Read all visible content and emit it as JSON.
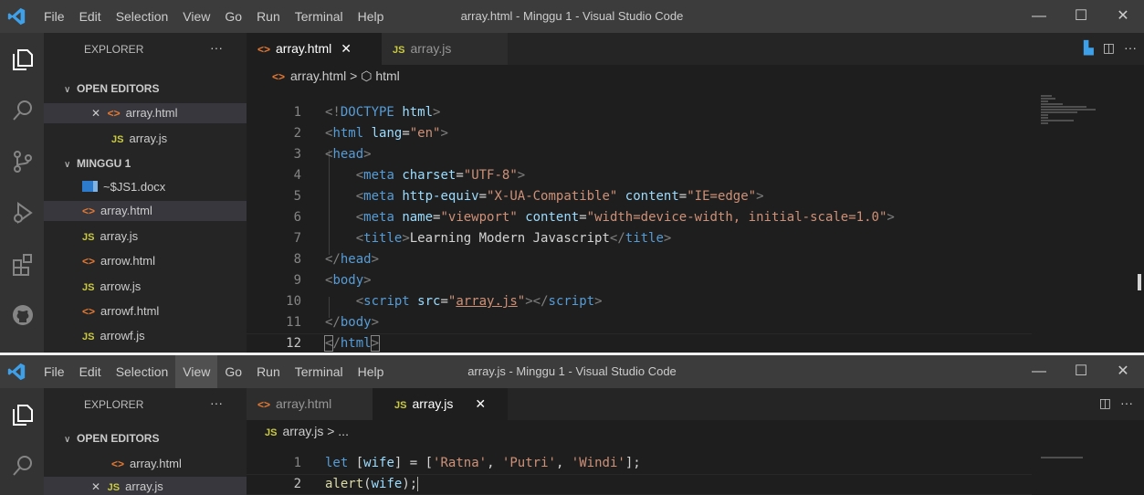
{
  "window1": {
    "menu": [
      "File",
      "Edit",
      "Selection",
      "View",
      "Go",
      "Run",
      "Terminal",
      "Help"
    ],
    "title": "array.html - Minggu 1 - Visual Studio Code",
    "controls": {
      "minimize": "—",
      "maximize": "☐",
      "close": "✕"
    },
    "explorer": {
      "title": "EXPLORER",
      "more": "···",
      "open_editors": {
        "label": "OPEN EDITORS",
        "items": [
          {
            "icon": "<>",
            "name": "array.html"
          },
          {
            "icon": "JS",
            "name": "array.js"
          }
        ]
      },
      "folder": {
        "label": "MINGGU 1",
        "files": [
          {
            "icon": "doc",
            "name": "~$JS1.docx"
          },
          {
            "icon": "<>",
            "name": "array.html"
          },
          {
            "icon": "JS",
            "name": "array.js"
          },
          {
            "icon": "<>",
            "name": "arrow.html"
          },
          {
            "icon": "JS",
            "name": "arrow.js"
          },
          {
            "icon": "<>",
            "name": "arrowf.html"
          },
          {
            "icon": "JS",
            "name": "arrowf.js"
          }
        ]
      }
    },
    "tabs": [
      {
        "icon": "<>",
        "label": "array.html",
        "close": "✕"
      },
      {
        "icon": "JS",
        "label": "array.js"
      }
    ],
    "breadcrumb": {
      "icon": "<>",
      "file": "array.html",
      "sep": ">",
      "node": "html"
    },
    "line_numbers": [
      "1",
      "2",
      "3",
      "4",
      "5",
      "6",
      "7",
      "8",
      "9",
      "10",
      "11",
      "12"
    ],
    "accent": "#007acc"
  },
  "window2": {
    "menu": [
      "File",
      "Edit",
      "Selection",
      "View",
      "Go",
      "Run",
      "Terminal",
      "Help"
    ],
    "title": "array.js - Minggu 1 - Visual Studio Code",
    "controls": {
      "minimize": "—",
      "maximize": "☐",
      "close": "✕"
    },
    "explorer": {
      "title": "EXPLORER",
      "more": "···",
      "open_editors": {
        "label": "OPEN EDITORS",
        "items": [
          {
            "icon": "<>",
            "name": "array.html"
          },
          {
            "icon": "JS",
            "name": "array.js"
          }
        ]
      }
    },
    "tabs": [
      {
        "icon": "<>",
        "label": "array.html"
      },
      {
        "icon": "JS",
        "label": "array.js",
        "close": "✕"
      }
    ],
    "breadcrumb": {
      "icon": "JS",
      "file": "array.js",
      "sep": ">",
      "node": "..."
    },
    "line_numbers": [
      "1",
      "2"
    ]
  }
}
